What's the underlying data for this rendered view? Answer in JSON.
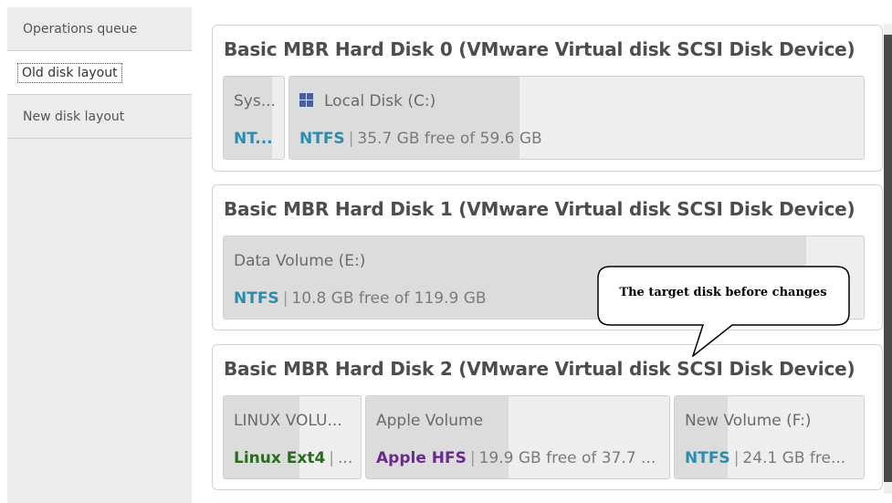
{
  "sidebar": {
    "items": [
      {
        "label": "Operations queue"
      },
      {
        "label": "Old disk layout"
      },
      {
        "label": "New disk layout"
      }
    ],
    "selected_index": 1
  },
  "disks": [
    {
      "title": "Basic MBR Hard Disk 0 (VMware Virtual disk SCSI Disk Device)",
      "partitions": [
        {
          "name": "Sys...",
          "fs": "NT...",
          "fs_color": "#2b8cae",
          "info": "",
          "used_fraction": 0.8
        },
        {
          "name": "Local Disk (C:)",
          "icon": "windows-icon",
          "fs": "NTFS",
          "fs_color": "#2b8cae",
          "info": "35.7 GB free of 59.6 GB",
          "used_fraction": 0.4
        }
      ]
    },
    {
      "title": "Basic MBR Hard Disk 1 (VMware Virtual disk SCSI Disk Device)",
      "partitions": [
        {
          "name": "Data Volume (E:)",
          "fs": "NTFS",
          "fs_color": "#2b8cae",
          "info": "10.8 GB free of 119.9 GB",
          "used_fraction": 0.91
        }
      ]
    },
    {
      "title": "Basic MBR Hard Disk 2 (VMware Virtual disk SCSI Disk Device)",
      "partitions": [
        {
          "name": "LINUX VOLU...",
          "fs": "Linux Ext4",
          "fs_color": "#2a6b1f",
          "info": "...",
          "used_fraction": 0.55
        },
        {
          "name": "Apple Volume",
          "fs": "Apple HFS",
          "fs_color": "#6a2a8e",
          "info": "19.9 GB free of 37.7 ...",
          "used_fraction": 0.47
        },
        {
          "name": "New Volume (F:)",
          "fs": "NTFS",
          "fs_color": "#2b8cae",
          "info": "24.1 GB fre...",
          "used_fraction": 0.28
        }
      ]
    }
  ],
  "callout": {
    "text": "The target disk before changes"
  }
}
